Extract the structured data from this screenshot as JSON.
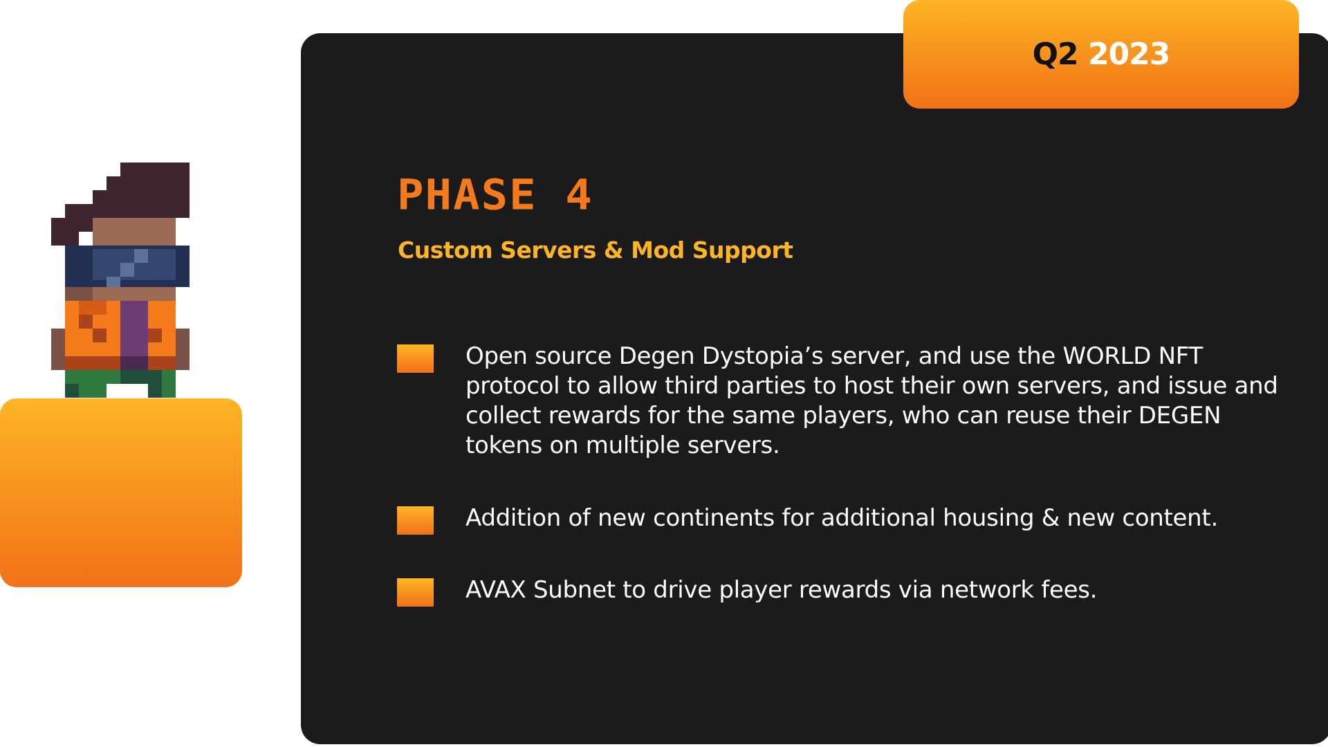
{
  "badge": {
    "quarter": "Q2",
    "year": "2023"
  },
  "phase": {
    "title": "PHASE 4",
    "subtitle": "Custom Servers & Mod Support"
  },
  "items": [
    {
      "text": "Open source Degen Dystopia’s server, and use the WORLD NFT protocol to allow third parties to host their own servers, and issue and collect rewards for the same players, who can reuse their DEGEN tokens on multiple servers."
    },
    {
      "text": "Addition of new continents for additional housing & new content."
    },
    {
      "text": "AVAX Subnet to drive player rewards via network fees."
    }
  ],
  "colors": {
    "orange_top": "#fdb525",
    "orange_bottom": "#f27118",
    "card_bg": "#1b1b1b",
    "title_orange": "#f47a1c",
    "subtitle_yellow": "#fdb525"
  },
  "icons": {
    "character": "pixel-character-icon",
    "bullet": "orange-square-bullet-icon"
  }
}
